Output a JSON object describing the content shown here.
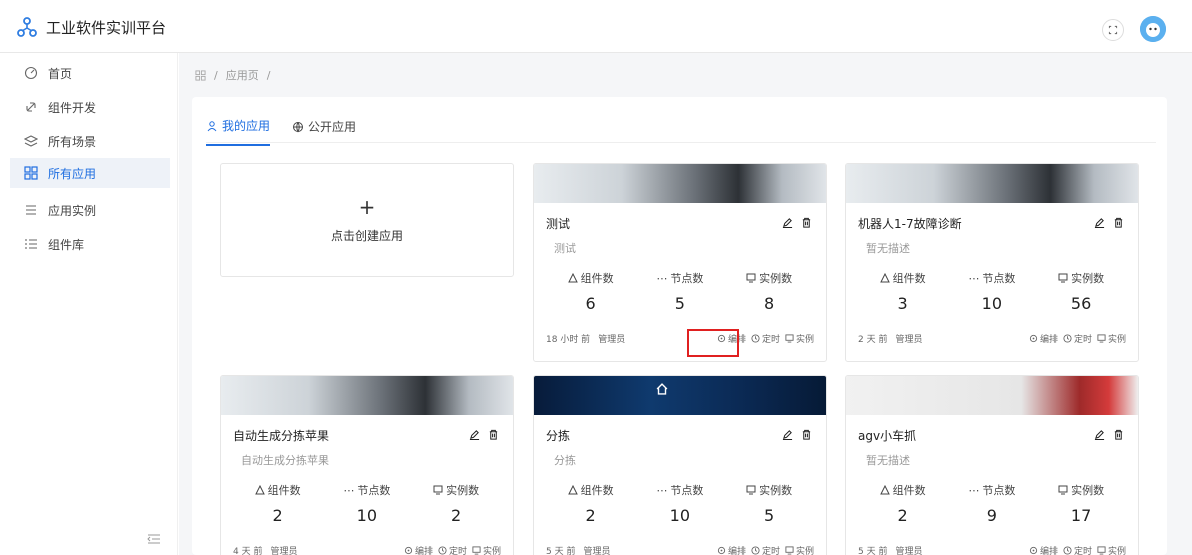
{
  "app": {
    "title": "工业软件实训平台"
  },
  "sidebar": {
    "items": [
      {
        "label": "首页",
        "icon": "dashboard-icon",
        "active": false
      },
      {
        "label": "组件开发",
        "icon": "link-icon",
        "active": false
      },
      {
        "label": "所有场景",
        "icon": "layers-icon",
        "active": false
      },
      {
        "label": "所有应用",
        "icon": "grid-icon",
        "active": true
      },
      {
        "label": "应用实例",
        "icon": "list-icon",
        "active": false
      },
      {
        "label": "组件库",
        "icon": "list-number-icon",
        "active": false
      }
    ]
  },
  "breadcrumb": {
    "home_icon": "grid-icon",
    "current": "应用页",
    "separator": "/"
  },
  "tabs": [
    {
      "label": "我的应用",
      "icon": "user-icon",
      "active": true
    },
    {
      "label": "公开应用",
      "icon": "globe-icon",
      "active": false
    }
  ],
  "create": {
    "plus": "+",
    "label": "点击创建应用"
  },
  "labels": {
    "components": "组件数",
    "nodes": "节点数",
    "instances": "实例数",
    "edit": "编排",
    "schedule": "定时",
    "instance": "实例"
  },
  "cards": [
    {
      "title": "测试",
      "desc": "测试",
      "components": "6",
      "nodes": "5",
      "instances": "8",
      "time": "18 小时 前",
      "owner": "管理员",
      "banner": "robot"
    },
    {
      "title": "机器人1-7故障诊断",
      "desc": "暂无描述",
      "components": "3",
      "nodes": "10",
      "instances": "56",
      "time": "2 天 前",
      "owner": "管理员",
      "banner": "robot"
    },
    {
      "title": "自动生成分拣苹果",
      "desc": "自动生成分拣苹果",
      "components": "2",
      "nodes": "10",
      "instances": "2",
      "time": "4 天 前",
      "owner": "管理员",
      "banner": "robot"
    },
    {
      "title": "分拣",
      "desc": "分拣",
      "components": "2",
      "nodes": "10",
      "instances": "5",
      "time": "5 天 前",
      "owner": "管理员",
      "banner": "tech"
    },
    {
      "title": "agv小车抓",
      "desc": "暂无描述",
      "components": "2",
      "nodes": "9",
      "instances": "17",
      "time": "5 天 前",
      "owner": "管理员",
      "banner": "agv"
    }
  ],
  "colors": {
    "accent": "#1f6ee0",
    "highlight": "#e02020",
    "background": "#f5f6f8"
  }
}
